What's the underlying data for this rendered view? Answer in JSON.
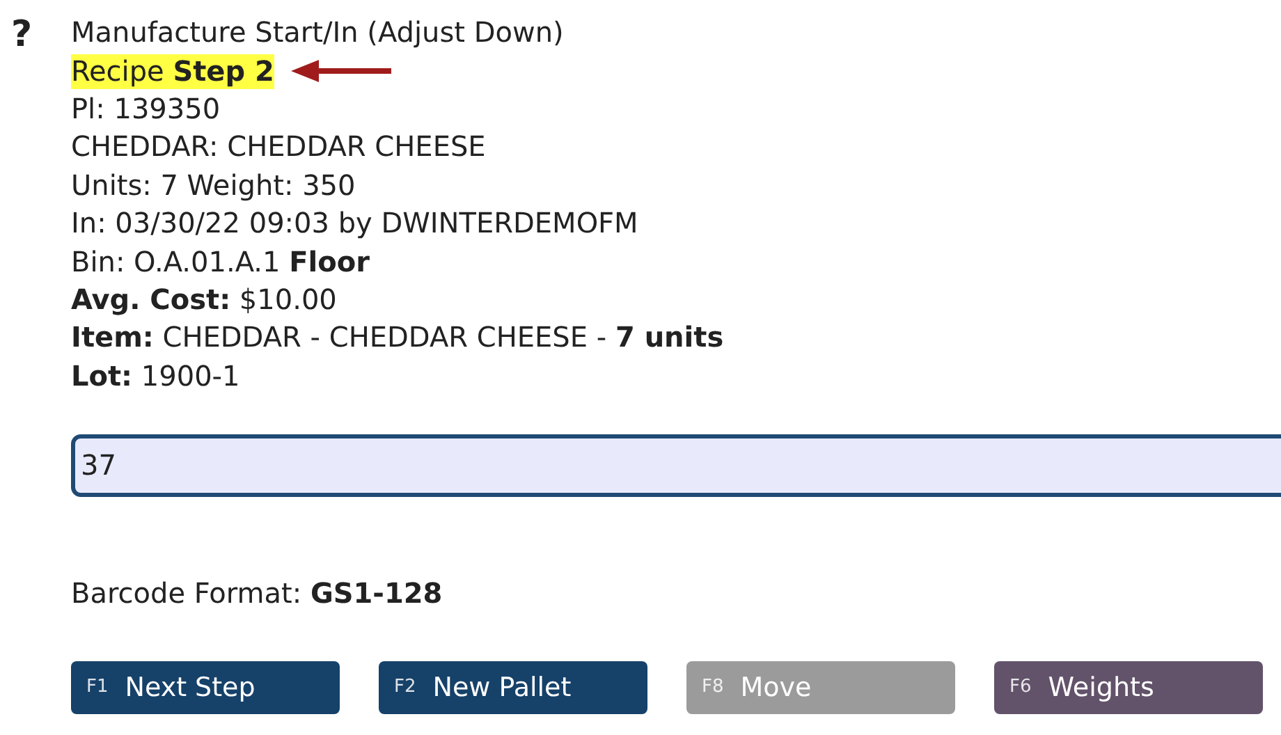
{
  "help_icon": "?",
  "lines": [
    {
      "text": "Manufacture Start/In (Adjust Down)",
      "highlighted": false
    },
    {
      "text": "Recipe **Step 2**",
      "highlighted": true,
      "pointer_arrow": true
    },
    {
      "text": "Pl: 139350",
      "highlighted": false
    },
    {
      "text": "CHEDDAR: CHEDDAR CHEESE",
      "highlighted": false
    },
    {
      "text": "Units: 7 Weight: 350",
      "highlighted": false
    },
    {
      "text": "In: 03/30/22 09:03 by DWINTERDEMOFM",
      "highlighted": false
    },
    {
      "text": "Bin: O.A.01.A.1 **Floor**",
      "highlighted": false
    },
    {
      "text": "**Avg. Cost:** $10.00",
      "highlighted": false
    },
    {
      "text": "**Item:** CHEDDAR - CHEDDAR CHEESE - **7 units**",
      "highlighted": false
    },
    {
      "text": "**Lot:** 1900-1",
      "highlighted": false
    }
  ],
  "input": {
    "value": "37"
  },
  "barcode_format": "Barcode Format: **GS1-128**",
  "buttons": [
    {
      "key": "F1",
      "label": "Next Step",
      "kind": "primary",
      "disabled": false
    },
    {
      "key": "F2",
      "label": "New Pallet",
      "kind": "primary",
      "disabled": false
    },
    {
      "key": "F8",
      "label": "Move",
      "kind": "primary",
      "disabled": true
    },
    {
      "key": "F6",
      "label": "Weights",
      "kind": "secondary",
      "disabled": false
    }
  ]
}
